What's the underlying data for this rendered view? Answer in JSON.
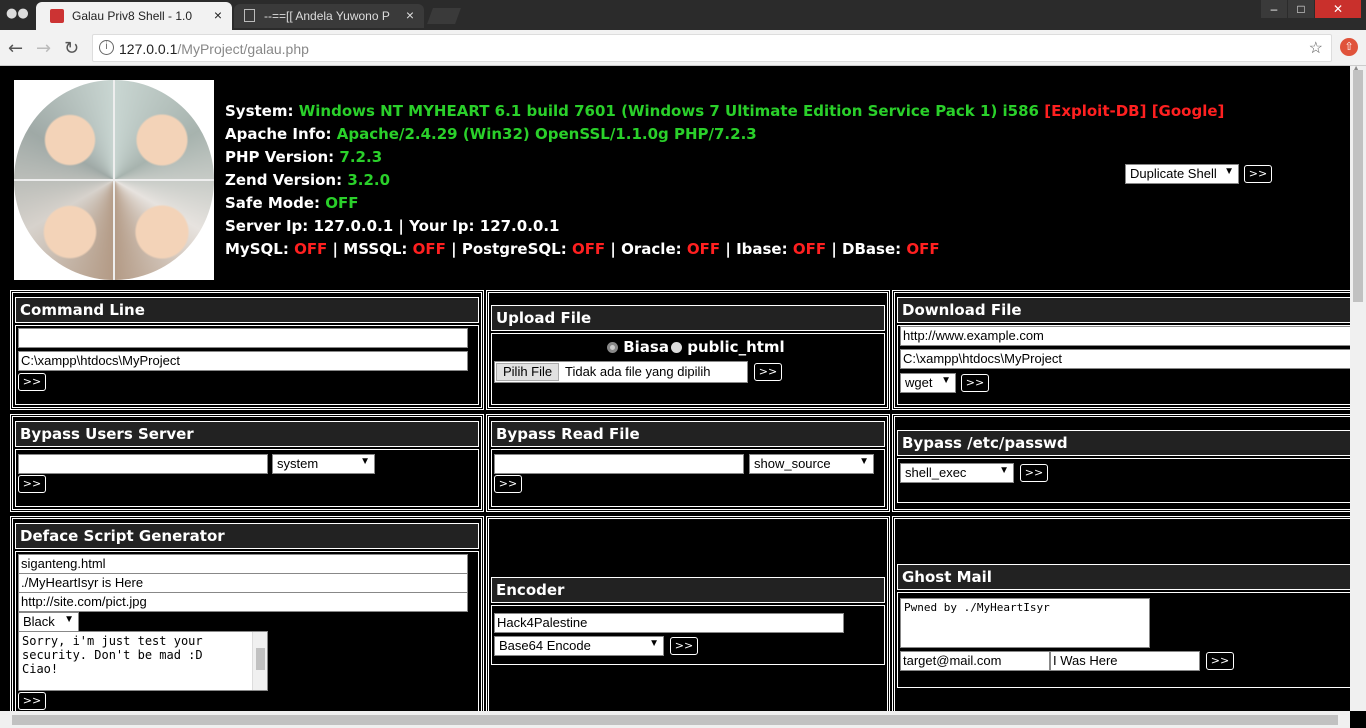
{
  "browser": {
    "tabs": [
      {
        "title": "Galau Priv8 Shell - 1.0",
        "active": true
      },
      {
        "title": "--==[[ Andela Yuwono P",
        "active": false
      }
    ],
    "url_host": "127.0.0.1",
    "url_path": "/MyProject/galau.php",
    "icons": [
      "incognito-icon",
      "back-icon",
      "forward-icon",
      "reload-icon",
      "info-icon",
      "star-icon",
      "extension-icon"
    ]
  },
  "info": {
    "system_label": "System:",
    "system_value": "Windows NT MYHEART 6.1 build 7601 (Windows 7 Ultimate Edition Service Pack 1) i586",
    "exploitdb": "[Exploit-DB]",
    "google": "[Google]",
    "apache_label": "Apache Info:",
    "apache_value": "Apache/2.4.29 (Win32) OpenSSL/1.1.0g PHP/7.2.3",
    "php_label": "PHP Version:",
    "php_value": "7.2.3",
    "zend_label": "Zend Version:",
    "zend_value": "3.2.0",
    "safe_label": "Safe Mode:",
    "safe_value": "OFF",
    "server_ip": "Server Ip: 127.0.0.1 | Your Ip: 127.0.0.1",
    "mysql_label": "MySQL:",
    "mssql_label": "MSSQL:",
    "pgsql_label": "PostgreSQL:",
    "oracle_label": "Oracle:",
    "ibase_label": "Ibase:",
    "dbase_label": "DBase:",
    "off": "OFF",
    "sep": "|"
  },
  "duplicate": {
    "select": "Duplicate Shell",
    "button": ">>"
  },
  "command_line": {
    "title": "Command Line",
    "cmd_value": "",
    "path_value": "C:\\xampp\\htdocs\\MyProject",
    "button": ">>"
  },
  "upload_file": {
    "title": "Upload File",
    "radio1": "Biasa",
    "radio2": "public_html",
    "choose": "Pilih File",
    "no_file": "Tidak ada file yang dipilih",
    "button": ">>"
  },
  "download_file": {
    "title": "Download File",
    "url_value": "http://www.example.com",
    "path_value": "C:\\xampp\\htdocs\\MyProject",
    "method": "wget",
    "button": ">>"
  },
  "bypass_users": {
    "title": "Bypass Users Server",
    "input_value": "",
    "method": "system",
    "button": ">>"
  },
  "bypass_read": {
    "title": "Bypass Read File",
    "input_value": "",
    "method": "show_source",
    "button": ">>"
  },
  "bypass_passwd": {
    "title": "Bypass /etc/passwd",
    "method": "shell_exec",
    "button": ">>"
  },
  "deface": {
    "title": "Deface Script Generator",
    "filename": "siganteng.html",
    "header": "./MyHeartIsyr is Here",
    "image": "http://site.com/pict.jpg",
    "color": "Black",
    "message": "Sorry, i'm just test your\nsecurity. Don't be mad :D\nCiao!",
    "button": ">>"
  },
  "encoder": {
    "title": "Encoder",
    "input_value": "Hack4Palestine",
    "method": "Base64 Encode",
    "button": ">>"
  },
  "ghost_mail": {
    "title": "Ghost Mail",
    "message": "Pwned by ./MyHeartIsyr",
    "to": "target@mail.com",
    "subject": "I Was Here",
    "button": ">>"
  }
}
